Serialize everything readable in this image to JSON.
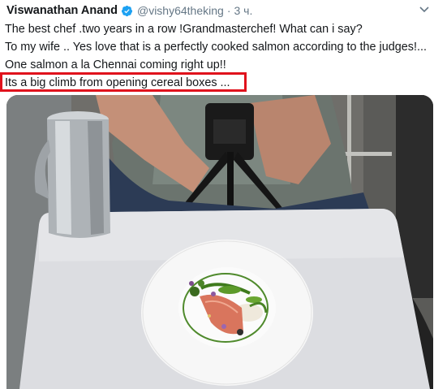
{
  "tweet": {
    "author_name": "Viswanathan Anand",
    "handle": "@vishy64theking",
    "separator": "·",
    "time": "3 ч.",
    "lines": [
      "The best chef .two years in a row !Grandmasterchef! What can i say?",
      "To my wife .. Yes love that is a perfectly cooked salmon according to the judges!...",
      "One salmon a la Chennai coming right up!!",
      "Its a big climb from opening cereal boxes ..."
    ]
  },
  "icons": {
    "verified": "verified-badge-icon",
    "more": "chevron-down-icon"
  },
  "colors": {
    "accent": "#1da1f2",
    "highlight_box": "#e0121c"
  }
}
